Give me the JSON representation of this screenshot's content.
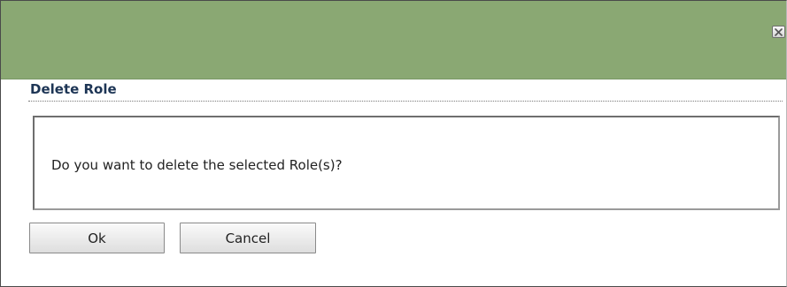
{
  "dialog": {
    "close_icon": "close-icon",
    "title": "Delete Role",
    "message": "Do you want to delete the selected Role(s)?",
    "buttons": {
      "ok_label": "Ok",
      "cancel_label": "Cancel"
    },
    "colors": {
      "titlebar": "#8aa873",
      "heading_text": "#1d3555"
    }
  }
}
